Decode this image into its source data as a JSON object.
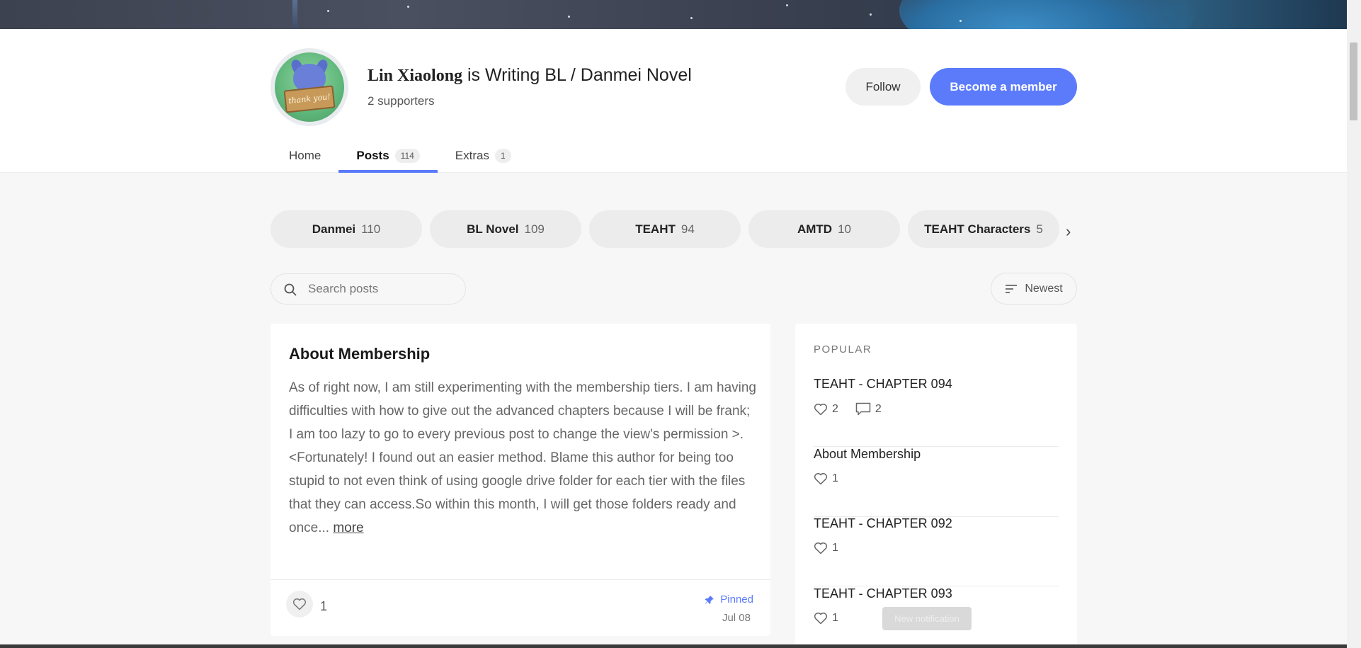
{
  "creator": {
    "name": "Lin Xiaolong",
    "tagline": "is Writing BL / Danmei Novel",
    "supporters": "2 supporters",
    "avatar_text": "thank you!"
  },
  "actions": {
    "follow": "Follow",
    "member": "Become a member"
  },
  "tabs": [
    {
      "label": "Home",
      "count": ""
    },
    {
      "label": "Posts",
      "count": "114"
    },
    {
      "label": "Extras",
      "count": "1"
    }
  ],
  "tags": [
    {
      "label": "Danmei",
      "count": "110"
    },
    {
      "label": "BL Novel",
      "count": "109"
    },
    {
      "label": "TEAHT",
      "count": "94"
    },
    {
      "label": "AMTD",
      "count": "10"
    },
    {
      "label": "TEAHT Characters",
      "count": "5"
    }
  ],
  "search": {
    "placeholder": "Search posts"
  },
  "sort": {
    "label": "Newest"
  },
  "post": {
    "title": "About Membership",
    "body": "As of right now, I am still experimenting with the membership tiers. I am having difficulties with how to give out the advanced chapters because I will be frank; I am too lazy to go to every previous post to change the view's permission >.<Fortunately! I found out an easier method. Blame this author for being too stupid to not even think of using google drive folder for each tier with the files that they can access.So within this month, I will get those folders ready and once... ",
    "more": "more",
    "likes": "1",
    "pinned": "Pinned",
    "date": "Jul 08"
  },
  "popular": {
    "heading": "POPULAR",
    "items": [
      {
        "title": "TEAHT - CHAPTER 094",
        "likes": "2",
        "comments": "2"
      },
      {
        "title": "About Membership",
        "likes": "1",
        "comments": ""
      },
      {
        "title": "TEAHT - CHAPTER 092",
        "likes": "1",
        "comments": ""
      },
      {
        "title": "TEAHT - CHAPTER 093",
        "likes": "1",
        "comments": ""
      }
    ]
  },
  "toast": {
    "text": "New notification"
  },
  "colors": {
    "accent": "#5b7bfb",
    "chip_bg": "#ececec",
    "page_bg": "#f7f7f7"
  }
}
